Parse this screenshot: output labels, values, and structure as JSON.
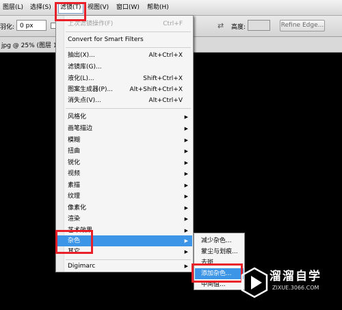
{
  "menubar": {
    "items": [
      {
        "label": "图层(L)"
      },
      {
        "label": "选择(S)"
      },
      {
        "label": "滤镜(T)"
      },
      {
        "label": "视图(V)"
      },
      {
        "label": "窗口(W)"
      },
      {
        "label": "帮助(H)"
      }
    ]
  },
  "options_bar": {
    "feather_label": "羽化:",
    "feather_value": "0 px",
    "height_label": "高度:",
    "refine_edge_label": "Refine Edge..."
  },
  "document_tab": {
    "title": "jpg @ 25% (图层 1"
  },
  "filter_menu": {
    "items": [
      {
        "label": "上次滤镜操作(F)",
        "shortcut": "Ctrl+F",
        "disabled": true
      },
      {
        "label": "Convert for Smart Filters",
        "shortcut": ""
      },
      {
        "label": "抽出(X)...",
        "shortcut": "Alt+Ctrl+X"
      },
      {
        "label": "滤镜库(G)...",
        "shortcut": ""
      },
      {
        "label": "液化(L)...",
        "shortcut": "Shift+Ctrl+X"
      },
      {
        "label": "图案生成器(P)...",
        "shortcut": "Alt+Shift+Ctrl+X"
      },
      {
        "label": "消失点(V)...",
        "shortcut": "Alt+Ctrl+V"
      },
      {
        "label": "风格化",
        "submenu": true
      },
      {
        "label": "画笔描边",
        "submenu": true
      },
      {
        "label": "模糊",
        "submenu": true
      },
      {
        "label": "扭曲",
        "submenu": true
      },
      {
        "label": "锐化",
        "submenu": true
      },
      {
        "label": "视频",
        "submenu": true
      },
      {
        "label": "素描",
        "submenu": true
      },
      {
        "label": "纹理",
        "submenu": true
      },
      {
        "label": "像素化",
        "submenu": true
      },
      {
        "label": "渲染",
        "submenu": true
      },
      {
        "label": "艺术效果",
        "submenu": true
      },
      {
        "label": "杂色",
        "submenu": true,
        "highlighted": true
      },
      {
        "label": "其它",
        "submenu": true
      },
      {
        "label": "Digimarc",
        "submenu": true
      }
    ]
  },
  "noise_submenu": {
    "items": [
      {
        "label": "减少杂色..."
      },
      {
        "label": "蒙尘与划痕..."
      },
      {
        "label": "去斑"
      },
      {
        "label": "添加杂色...",
        "highlighted": true
      },
      {
        "label": "中间值..."
      }
    ]
  },
  "watermark": {
    "name": "溜溜自学",
    "url": "ZIXUE.3066.COM"
  },
  "colors": {
    "highlight": "#3d95e8",
    "annotation": "#e8202a"
  }
}
